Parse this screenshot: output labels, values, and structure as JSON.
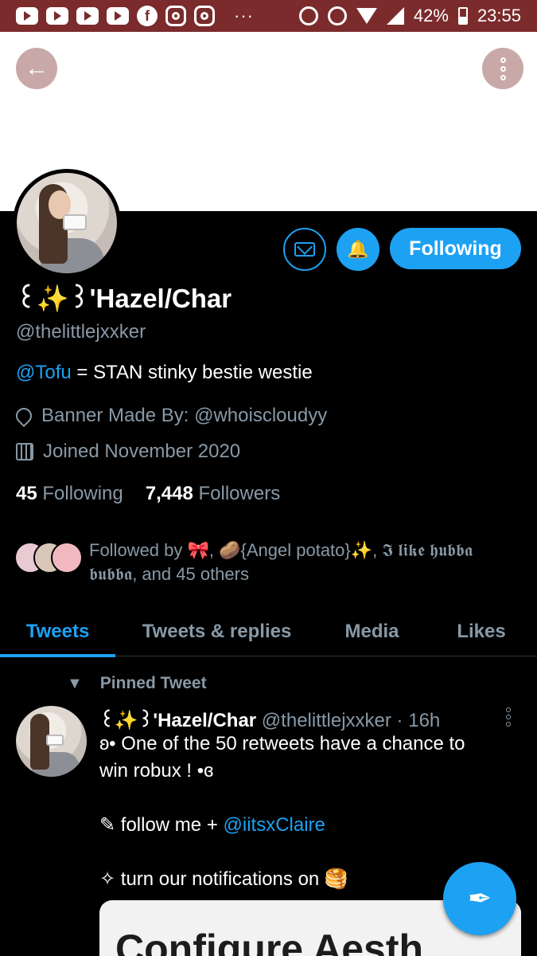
{
  "status_bar": {
    "battery": "42%",
    "time": "23:55",
    "more_dots": "···"
  },
  "header": {
    "back_icon": "arrow-left-icon",
    "more_icon": "more-vertical-icon"
  },
  "profile": {
    "display_name_prefix": "꒰",
    "display_name_spark": "✨",
    "display_name_main": "꒱'Hazel/Char",
    "handle": "@thelittlejxxker",
    "bio_mention": "@Tofu",
    "bio_rest": " = STAN stinky bestie westie",
    "location": "Banner Made By: @whoiscloudyy",
    "joined": "Joined November 2020",
    "following_count": "45",
    "following_label": "Following",
    "followers_count": "7,448",
    "followers_label": "Followers",
    "followed_by": "Followed by 🎀, 🥔{Angel potato}✨, 𝕴 𝖑𝖎𝖐𝖊 𝖍𝖚𝖇𝖇𝖆 𝖇𝖚𝖇𝖇𝖆, and 45 others"
  },
  "actions": {
    "following_button": "Following",
    "message_icon": "envelope-icon",
    "notification_icon": "bell-check-icon"
  },
  "tabs": [
    {
      "label": "Tweets",
      "active": true
    },
    {
      "label": "Tweets & replies",
      "active": false
    },
    {
      "label": "Media",
      "active": false
    },
    {
      "label": "Likes",
      "active": false
    }
  ],
  "tweet": {
    "pinned_label": "Pinned Tweet",
    "author_prefix": "꒰",
    "author_spark": "✨",
    "author_main": "꒱'Hazel/Char",
    "author_meta": " @thelittlejxxker · 16h",
    "line1": "ʚ• One of the 50 retweets have a chance to",
    "line2": "win robux ! •ɞ",
    "line3_prefix": "✎ follow me + ",
    "line3_mention": "@iitsxClaire",
    "line4": "✧ turn our notifications on 🥞",
    "card_text": "Configure Aesth"
  },
  "colors": {
    "accent": "#1da1f2",
    "status_bar": "#7b2b2c",
    "muted": "#8899a6"
  }
}
